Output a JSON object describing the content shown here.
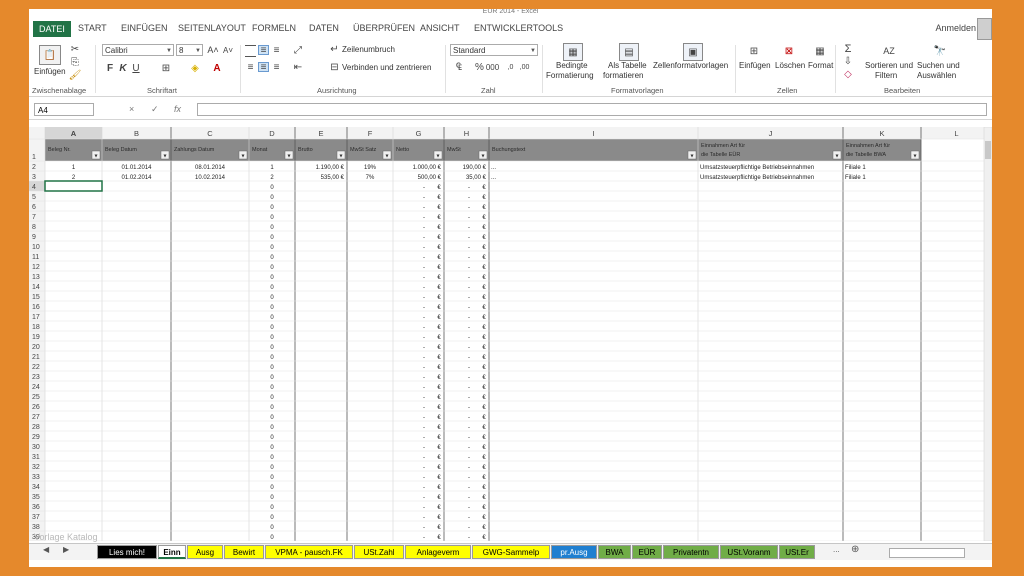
{
  "window": {
    "title": "EÜR 2014 - Excel"
  },
  "ribbon_tabs": [
    {
      "label": "DATEI",
      "active": true
    },
    {
      "label": "START",
      "active": false
    },
    {
      "label": "EINFÜGEN",
      "active": false
    },
    {
      "label": "SEITENLAYOUT",
      "active": false
    },
    {
      "label": "FORMELN",
      "active": false
    },
    {
      "label": "DATEN",
      "active": false
    },
    {
      "label": "ÜBERPRÜFEN",
      "active": false
    },
    {
      "label": "ANSICHT",
      "active": false
    },
    {
      "label": "ENTWICKLERTOOLS",
      "active": false
    }
  ],
  "account": {
    "label": "Anmelden"
  },
  "ribbon": {
    "paste_label": "Einfügen",
    "font_name": "Calibri",
    "font_size": "8",
    "wrap_label": "Zeilenumbruch",
    "merge_label": "Verbinden und zentrieren",
    "number_format": "Standard",
    "cond_format_1": "Bedingte",
    "cond_format_2": "Formatierung",
    "as_table_1": "Als Tabelle",
    "as_table_2": "formatieren",
    "cell_styles": "Zellenformatvorlagen",
    "insert_label": "Einfügen",
    "delete_label": "Löschen",
    "format_label": "Format",
    "sort_1": "Sortieren und",
    "sort_2": "Filtern",
    "find_1": "Suchen und",
    "find_2": "Auswählen",
    "groups": [
      "Zwischenablage",
      "Schriftart",
      "Ausrichtung",
      "Zahl",
      "Formatvorlagen",
      "Zellen",
      "Bearbeiten"
    ]
  },
  "formula_bar": {
    "cell_ref": "A4",
    "cancel": "×",
    "enter": "✓",
    "fx": "fx",
    "content": ""
  },
  "columns": [
    "A",
    "B",
    "C",
    "D",
    "E",
    "F",
    "G",
    "H",
    "I",
    "J",
    "K",
    "L"
  ],
  "header_cells": [
    "Beleg Nr.",
    "Beleg Datum",
    "Zahlungs Datum",
    "Monat",
    "Brutto",
    "MwSt Satz",
    "Netto",
    "MwSt",
    "Buchungstext",
    "Einnahmen Art für die Tabelle EÜR",
    "Einnahmen Art für die Tabelle BWA",
    ""
  ],
  "data_rows": [
    [
      "1",
      "01.01.2014",
      "08.01.2014",
      "1",
      "1.190,00 €",
      "19%",
      "1.000,00 €",
      "190,00 €",
      "...",
      "Umsatzsteuerpflichtige Betriebseinnahmen",
      "Filiale 1"
    ],
    [
      "2",
      "01.02.2014",
      "10.02.2014",
      "2",
      "535,00 €",
      "7%",
      "500,00 €",
      "35,00 €",
      "...",
      "Umsatzsteuerpflichtige Betriebseinnahmen",
      "Filiale 1"
    ]
  ],
  "row_numbers": [
    "1",
    "2",
    "3",
    "4",
    "5",
    "6",
    "7",
    "8",
    "9",
    "10",
    "11",
    "12",
    "13",
    "14",
    "15",
    "16",
    "17",
    "18",
    "19",
    "20",
    "21",
    "22",
    "23",
    "24",
    "25",
    "26",
    "27",
    "28",
    "29",
    "30",
    "31",
    "32",
    "33",
    "34",
    "35",
    "36",
    "37",
    "38",
    "39"
  ],
  "empty_row_values": {
    "monat": "0",
    "dash": "-",
    "euro": "€"
  },
  "sheet_tabs": [
    {
      "label": "Lies mich!",
      "bg": "#000000",
      "fg": "#ffffff",
      "active": false
    },
    {
      "label": "Einn",
      "bg": "#ffffff",
      "fg": "#000000",
      "active": true
    },
    {
      "label": "Ausg",
      "bg": "#ffff00",
      "fg": "#000000",
      "active": false
    },
    {
      "label": "Bewirt",
      "bg": "#ffff00",
      "fg": "#000000",
      "active": false
    },
    {
      "label": "VPMA - pausch.FK",
      "bg": "#ffff00",
      "fg": "#000000",
      "active": false
    },
    {
      "label": "USt.Zahl",
      "bg": "#ffff00",
      "fg": "#000000",
      "active": false
    },
    {
      "label": "Anlageverm",
      "bg": "#ffff00",
      "fg": "#000000",
      "active": false
    },
    {
      "label": "GWG-Sammelp",
      "bg": "#ffff00",
      "fg": "#000000",
      "active": false
    },
    {
      "label": "pr.Ausg",
      "bg": "#1f7fd0",
      "fg": "#ffffff",
      "active": false
    },
    {
      "label": "BWA",
      "bg": "#70ad47",
      "fg": "#000000",
      "active": false
    },
    {
      "label": "EÜR",
      "bg": "#70ad47",
      "fg": "#000000",
      "active": false
    },
    {
      "label": "Privatentn",
      "bg": "#70ad47",
      "fg": "#000000",
      "active": false
    },
    {
      "label": "USt.Voranm",
      "bg": "#70ad47",
      "fg": "#000000",
      "active": false
    },
    {
      "label": "USt.Er",
      "bg": "#70ad47",
      "fg": "#000000",
      "active": false
    }
  ],
  "sheet_overflow": "...",
  "watermark": "Vorlage Katalog",
  "colors": {
    "accent": "#217346",
    "frame": "#e5892c",
    "header_fill": "#808080"
  }
}
